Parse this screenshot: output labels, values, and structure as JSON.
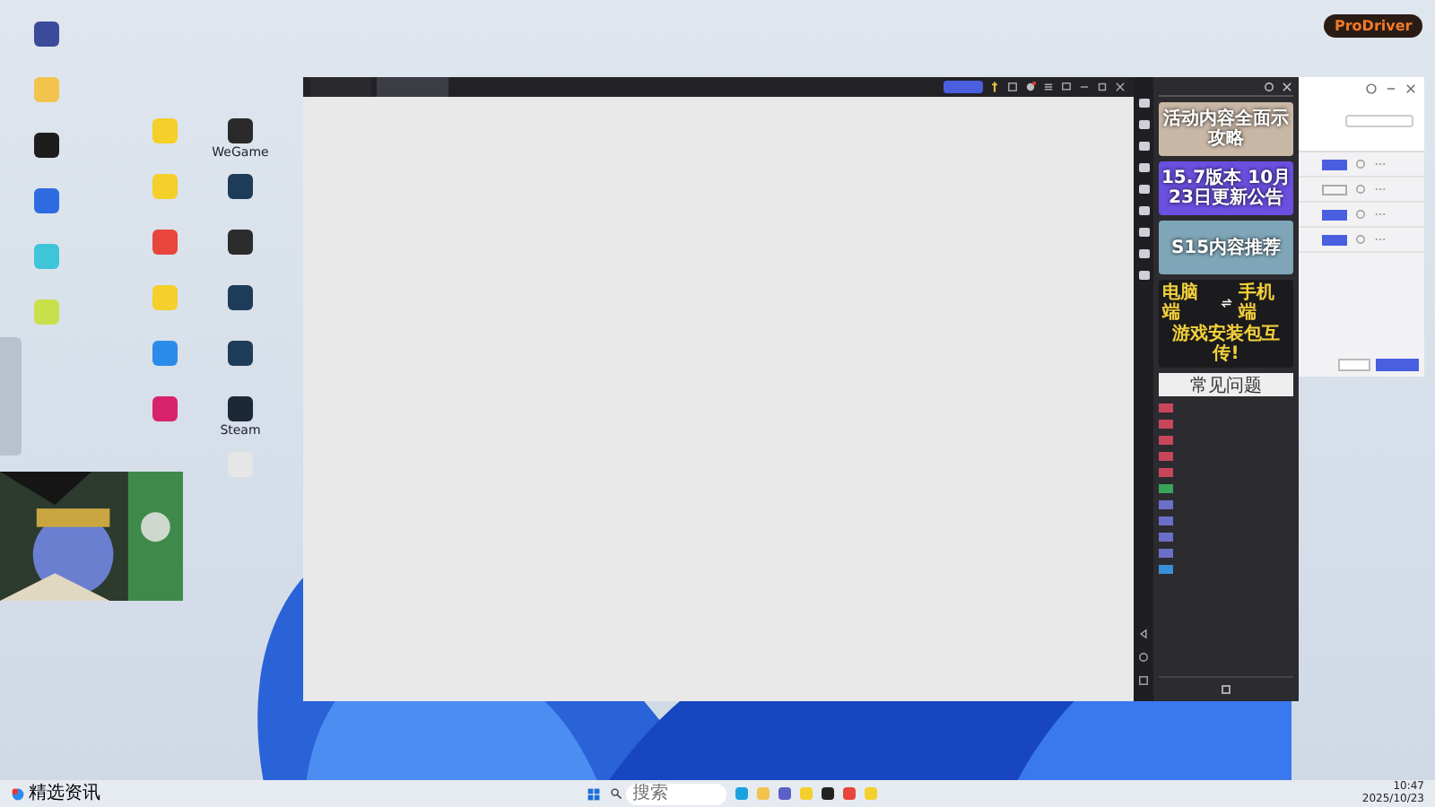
{
  "desktop": {
    "columns": [
      [
        {
          "color": "#3b4a9a"
        },
        {
          "color": "#f2c44e"
        },
        {
          "color": "#1d1d1d"
        },
        {
          "color": "#2f6be0"
        },
        {
          "color": "#3ec6d8"
        },
        {
          "color": "#c8e04a"
        }
      ],
      [
        {
          "color": "#f5cf2a"
        },
        {
          "color": "#f5cf2a"
        },
        {
          "color": "#e8453c"
        },
        {
          "color": "#f5cf2a"
        },
        {
          "color": "#2b8be8"
        },
        {
          "color": "#d8236b"
        }
      ],
      [
        {
          "label": "WeGame",
          "color": "#2a2a2a"
        },
        {
          "color": "#1e3c5a"
        },
        {
          "color": "#2c2c2c"
        },
        {
          "color": "#1e3c5a"
        },
        {
          "color": "#1e3c5a"
        },
        {
          "label": "Steam",
          "color": "#1b2838"
        },
        {
          "color": "#e6e6e6"
        }
      ]
    ]
  },
  "brand": {
    "label": "ProDriver"
  },
  "main_window": {
    "tabs": [
      {
        "selected": false
      },
      {
        "selected": true
      }
    ]
  },
  "side_panel": {
    "news": [
      {
        "banner": "活动内容全面示攻略",
        "color": "#c9b7a6"
      },
      {
        "banner": "15.7版本 10月23日更新公告",
        "color": "#6a4fe0"
      },
      {
        "banner": "S15内容推荐",
        "color": "#7fa6b8"
      }
    ],
    "transfer": {
      "left": "电脑端",
      "right": "手机端",
      "footer": "游戏安装包互传!"
    },
    "faq_button": "常见问题",
    "faq": [
      {
        "color": "#c8465a"
      },
      {
        "color": "#c8465a"
      },
      {
        "color": "#c8465a"
      },
      {
        "color": "#c8465a"
      },
      {
        "color": "#c8465a"
      },
      {
        "color": "#3aa35a"
      },
      {
        "color": "#6b6fc8"
      },
      {
        "color": "#6b6fc8"
      },
      {
        "color": "#6b6fc8"
      },
      {
        "color": "#6b6fc8"
      },
      {
        "color": "#3a8fd8"
      }
    ],
    "footer": {
      "checked": false
    }
  },
  "manager": {
    "rows": [
      {
        "on": false
      },
      {
        "on": true
      },
      {
        "on": false
      },
      {
        "on": false
      }
    ]
  },
  "taskbar": {
    "notice": {
      "title": "精选资讯"
    },
    "search": {
      "placeholder": "搜索"
    },
    "apps": [
      {
        "color": "#1aa1e0"
      },
      {
        "color": "#f2c44e"
      },
      {
        "color": "#5b5fc7"
      },
      {
        "color": "#f5cf2a"
      },
      {
        "color": "#222222"
      },
      {
        "color": "#e8453c"
      },
      {
        "color": "#f5cf2a"
      }
    ],
    "time": "10:47",
    "date": "2025/10/23"
  }
}
